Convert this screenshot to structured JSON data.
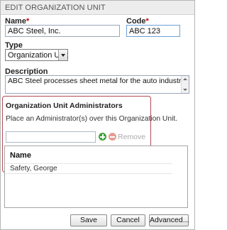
{
  "dialog": {
    "title": "EDIT ORGANIZATION UNIT"
  },
  "form": {
    "name_label": "Name",
    "name_value": "ABC Steel, Inc.",
    "code_label": "Code",
    "code_value": "ABC 123",
    "required_mark": "*",
    "type_label": "Type",
    "type_value": "Organization Unit",
    "description_label": "Description",
    "description_value": "ABC Steel processes sheet metal for the auto industry"
  },
  "administrators": {
    "title": "Organization Unit Administrators",
    "help": "Place an Administrator(s) over this Organization Unit.",
    "input_value": "",
    "add_icon": "add-icon",
    "remove_label": "Remove",
    "list_header": "Name",
    "rows": [
      "Safety, George"
    ]
  },
  "buttons": {
    "save": "Save",
    "cancel": "Cancel",
    "advanced": "Advanced..."
  },
  "colors": {
    "highlight_border": "#b14a52",
    "add_icon": "#3fa23a",
    "remove_icon": "#e79b93",
    "required": "#cc0000"
  }
}
